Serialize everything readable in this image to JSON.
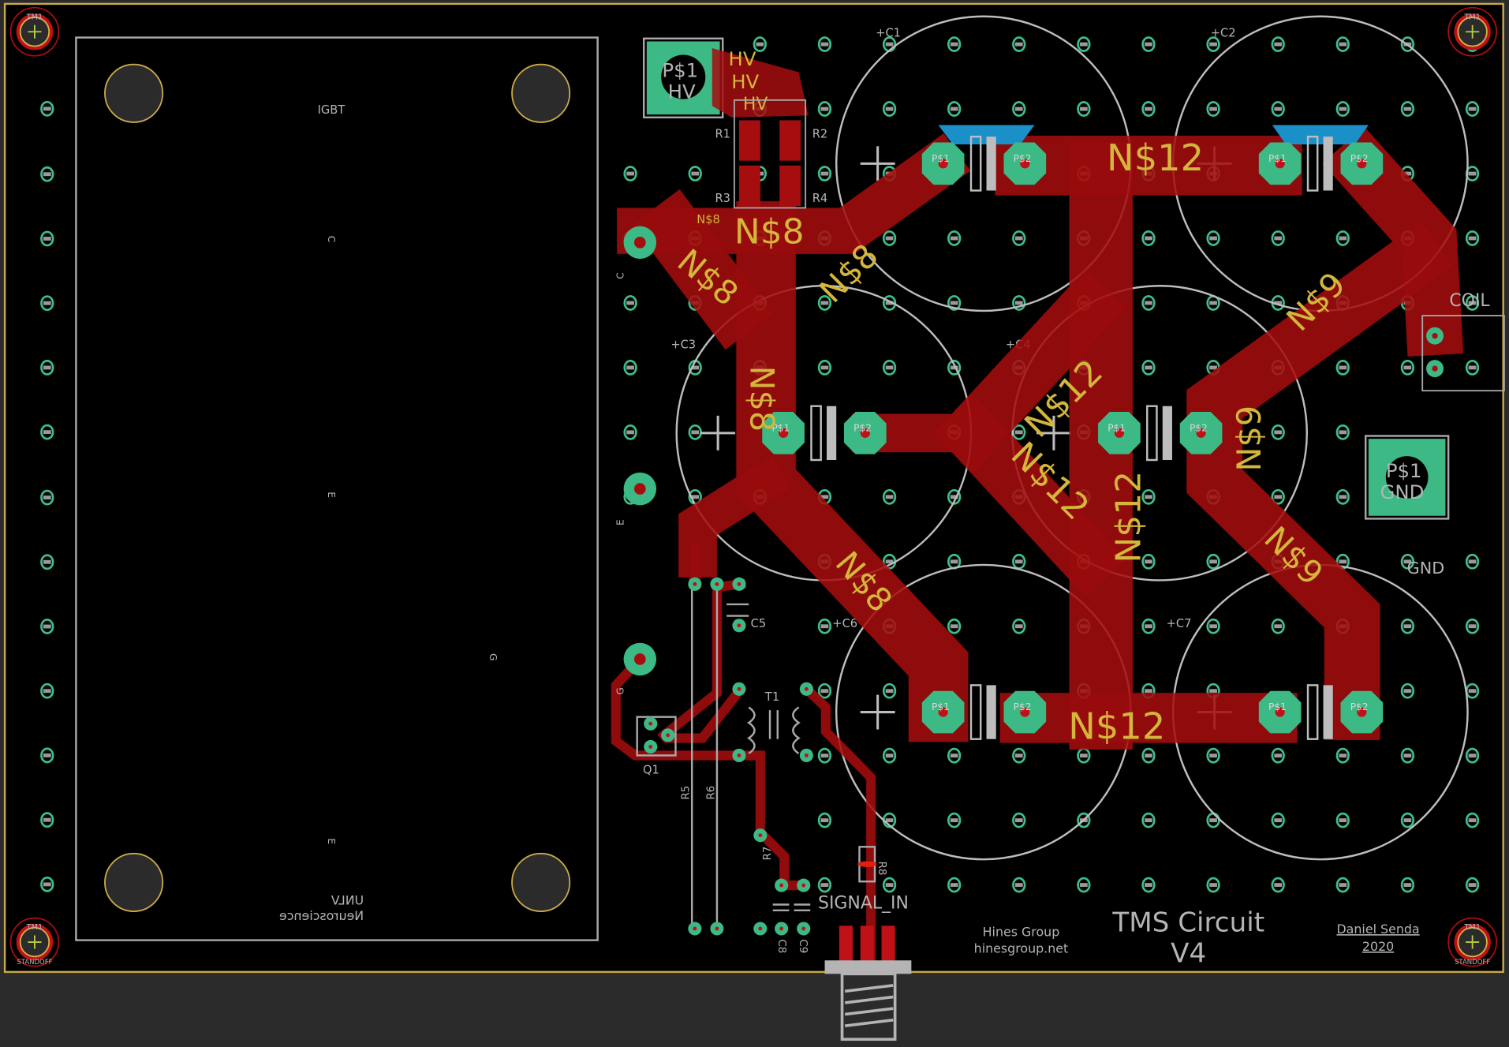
{
  "board": {
    "title": "TMS Circuit",
    "version": "V4",
    "group": "Hines Group",
    "website": "hinesgroup.net",
    "author": "Daniel Senda",
    "year": "2020",
    "mirrored_logo": [
      "UNLV",
      "Neuroscience"
    ],
    "colors": {
      "copper": "#a50d0f",
      "pad": "#3cb985",
      "silk": "#b4b4b4",
      "net_label": "#d4b63c",
      "board_edge": "#c8a84a"
    }
  },
  "components": {
    "igbt": "IGBT",
    "igbt_pins": [
      "C",
      "E",
      "E",
      "G"
    ],
    "caps": [
      "C1",
      "C2",
      "C3",
      "C4",
      "C6",
      "C7"
    ],
    "c5": "C5",
    "resistors": [
      "R1",
      "R2",
      "R3",
      "R4",
      "R5",
      "R6",
      "R7",
      "R8"
    ],
    "small_caps": [
      "C8",
      "C9"
    ],
    "transformer": "T1",
    "transistor": "Q1",
    "mount": "TM1",
    "standoff": "STANDOFF",
    "pin_c": "C",
    "pin_e": "E",
    "pin_g": "G"
  },
  "connectors": {
    "hv": {
      "pad": "P$1",
      "name": "HV"
    },
    "gnd": {
      "pad": "P$1",
      "name": "GND"
    },
    "gnd_label": "GND",
    "coil": "COIL",
    "signal_in": "SIGNAL_IN"
  },
  "pads": {
    "p1": "P$1",
    "p2": "P$2",
    "n8": "N$8",
    "n12": "N$12",
    "n9": "N$9"
  },
  "nets": {
    "n8": "N$8",
    "n9": "N$9",
    "n12": "N$12",
    "hv": "HV"
  }
}
